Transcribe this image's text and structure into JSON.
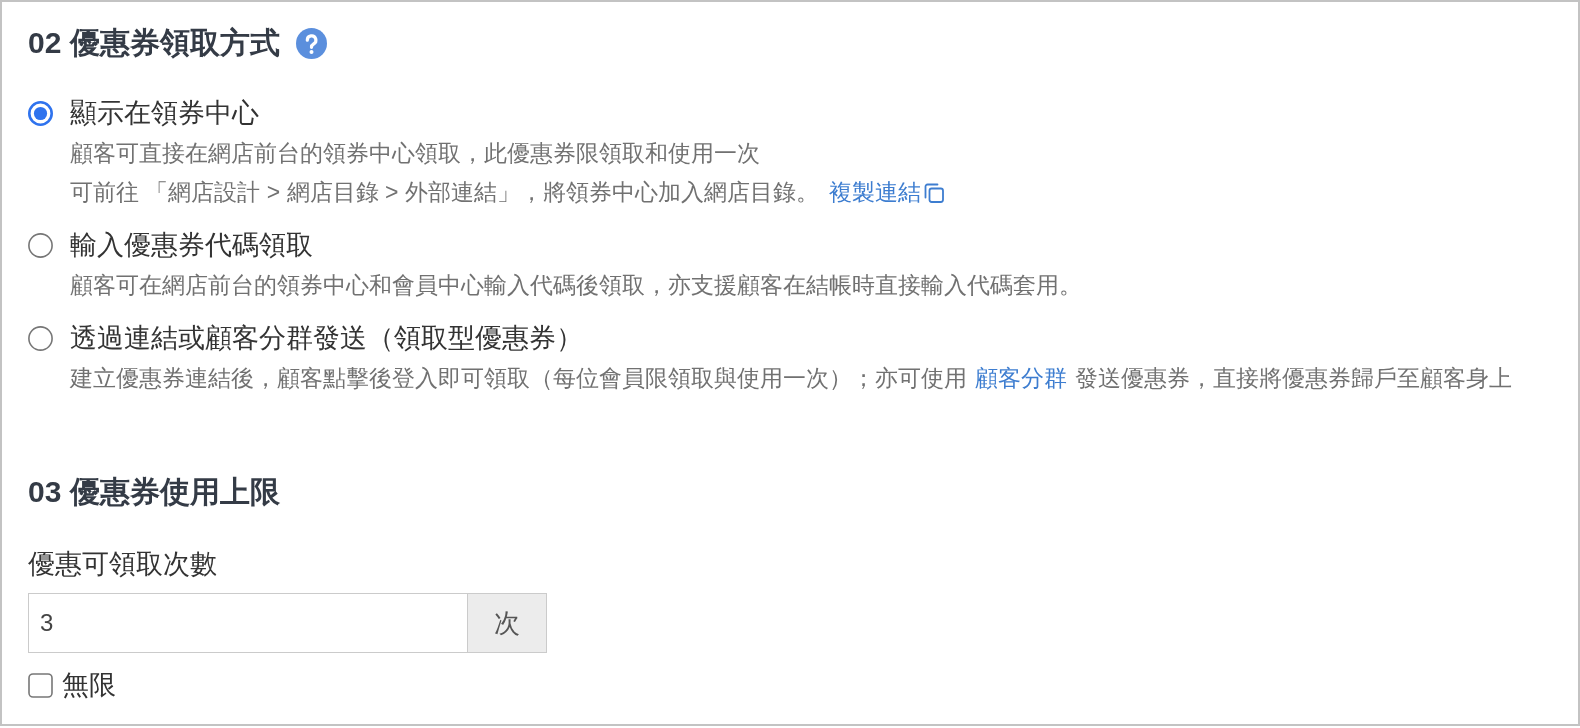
{
  "sections": [
    {
      "title": "02 優惠券領取方式",
      "help": true,
      "options": [
        {
          "label": "顯示在領券中心",
          "selected": true,
          "lines": [
            [
              {
                "kind": "text",
                "text": "顧客可直接在網店前台的領券中心領取，此優惠券限領取和使用一次"
              }
            ],
            [
              {
                "kind": "text",
                "text": "可前往 「網店設計 > 網店目錄 > 外部連結」，將領券中心加入網店目錄。"
              },
              {
                "kind": "copy_link",
                "text": "複製連結"
              }
            ]
          ]
        },
        {
          "label": "輸入優惠券代碼領取",
          "selected": false,
          "lines": [
            [
              {
                "kind": "text",
                "text": "顧客可在網店前台的領券中心和會員中心輸入代碼後領取，亦支援顧客在結帳時直接輸入代碼套用。"
              }
            ]
          ]
        },
        {
          "label": "透過連結或顧客分群發送（領取型優惠券）",
          "selected": false,
          "lines": [
            [
              {
                "kind": "text",
                "text": "建立優惠券連結後，顧客點擊後登入即可領取（每位會員限領取與使用一次）；亦可使用"
              },
              {
                "kind": "link",
                "text": "顧客分群"
              },
              {
                "kind": "text",
                "text": "發送優惠券，直接將優惠券歸戶至顧客身上"
              }
            ]
          ]
        }
      ]
    },
    {
      "title": "03 優惠券使用上限",
      "fields": [
        {
          "label": "優惠可領取次數",
          "value": "3",
          "unit": "次",
          "unlimited": {
            "label": "無限",
            "checked": false
          }
        }
      ]
    }
  ]
}
